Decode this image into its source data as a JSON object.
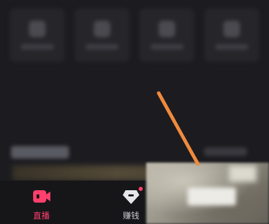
{
  "tabbar": {
    "items": [
      {
        "label": "直播",
        "icon": "live-camera-icon",
        "active": true,
        "color": "#ff3f6c"
      },
      {
        "label": "赚钱",
        "icon": "diamond-icon",
        "active": false,
        "badge": true,
        "color": "#c9c9cf"
      }
    ]
  },
  "colors": {
    "accent": "#ff3f6c",
    "background": "#1c1c20",
    "annotation_arrow": "#f08a3c"
  }
}
